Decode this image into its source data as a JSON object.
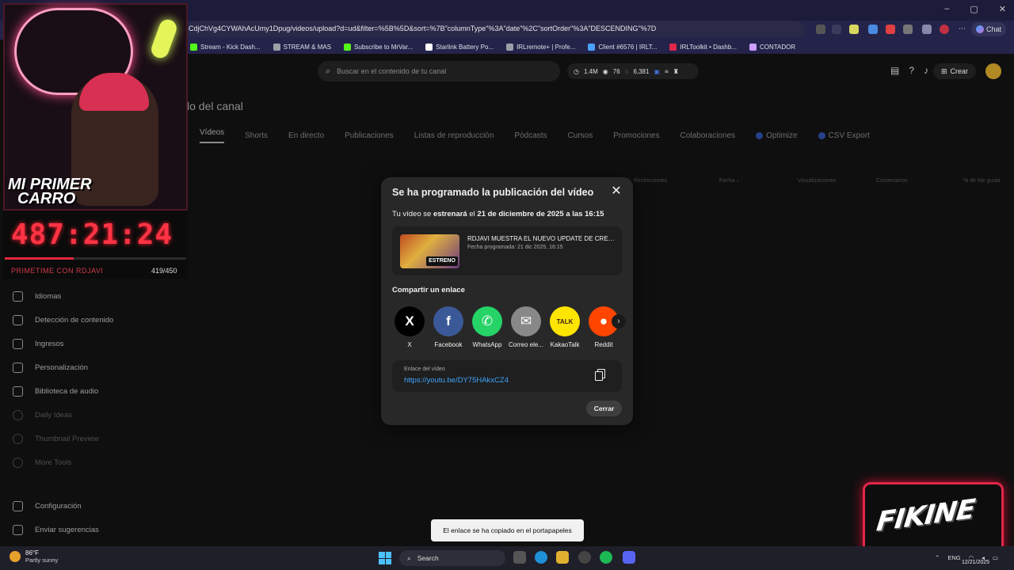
{
  "browser": {
    "url": "CdjChVg4CYWAhAcUmy1Dpug/videos/upload?d=ud&filter=%5B%5D&sort=%7B\"columnType\"%3A\"date\"%2C\"sortOrder\"%3A\"DESCENDING\"%7D",
    "chat_label": "Chat",
    "bookmarks": [
      "Stream - Kick Dash...",
      "STREAM & MAS",
      "Subscribe to MrVar...",
      "Starlink Battery Po...",
      "IRLremote+ | Profe...",
      "Client #6576 | IRLT...",
      "IRLToolkit • Dashb...",
      "CONTADOR"
    ],
    "bookmark_colors": [
      "#53fc18",
      "#9aa0a6",
      "#53fc18",
      "#ffffff",
      "#9aa0a6",
      "#4aa3ff",
      "#e0284a",
      "#c9a0ff"
    ]
  },
  "header": {
    "search_placeholder": "Buscar en el contenido de tu canal",
    "stat_subs": "1.4M",
    "stat_views": "76",
    "stat_other": "6,381",
    "create_label": "Crear"
  },
  "page": {
    "title": "lo del canal",
    "tabs": [
      "Vídeos",
      "Shorts",
      "En directo",
      "Publicaciones",
      "Listas de reproducción",
      "Pódcasts",
      "Cursos",
      "Promociones",
      "Colaboraciones",
      "Optimize",
      "CSV Export"
    ],
    "table_headers": [
      "Restricciones",
      "Fecha ↓",
      "Visualizaciones",
      "Comentarios",
      "% de Me gusta"
    ]
  },
  "sidebar": {
    "items": [
      "Idiomas",
      "Detección de contenido",
      "Ingresos",
      "Personalización",
      "Biblioteca de audio",
      "Daily Ideas",
      "Thumbnail Preview",
      "More Tools",
      "Configuración",
      "Enviar sugerencias"
    ]
  },
  "overlay": {
    "title_line1": "MI PRIMER",
    "title_line2": "CARRO",
    "timer": "487:21:24",
    "goal_label": "PRIMETIME CON RDJAVI",
    "goal_count": "419/450",
    "goal_progress": 0.38,
    "logo_text": "FIKINE"
  },
  "modal": {
    "title": "Se ha programado la publicación del vídeo",
    "premiere_prefix": "Tu vídeo se ",
    "premiere_word": "estrenará",
    "premiere_mid": " el ",
    "premiere_date": "21 de diciembre de 2025 a las 16:15",
    "thumb_badge": "ESTRENO",
    "video_title": "RDJAVI MUESTRA EL NUEVO UPDATE DE CREATI...",
    "video_date": "Fecha programada: 21 dic 2025, 16:15",
    "share_title": "Compartir un enlace",
    "share_targets": [
      {
        "label": "X",
        "glyph": "X",
        "bg": "#000000",
        "fg": "#ffffff"
      },
      {
        "label": "Facebook",
        "glyph": "f",
        "bg": "#3b5998",
        "fg": "#ffffff"
      },
      {
        "label": "WhatsApp",
        "glyph": "✆",
        "bg": "#25d366",
        "fg": "#ffffff"
      },
      {
        "label": "Correo ele...",
        "glyph": "✉",
        "bg": "#888888",
        "fg": "#ffffff"
      },
      {
        "label": "KakaoTalk",
        "glyph": "TALK",
        "bg": "#fee500",
        "fg": "#3c1e1e"
      },
      {
        "label": "Reddit",
        "glyph": "●",
        "bg": "#ff4500",
        "fg": "#ffffff"
      }
    ],
    "link_label": "Enlace del vídeo",
    "link_url": "https://youtu.be/DY75HAkxCZ4",
    "close_label": "Cerrar"
  },
  "toast": "El enlace se ha copiado en el portapapeles",
  "taskbar": {
    "temp": "86°F",
    "condition": "Partly sunny",
    "search_label": "Search",
    "lang": "ENG",
    "date": "12/21/2025"
  }
}
